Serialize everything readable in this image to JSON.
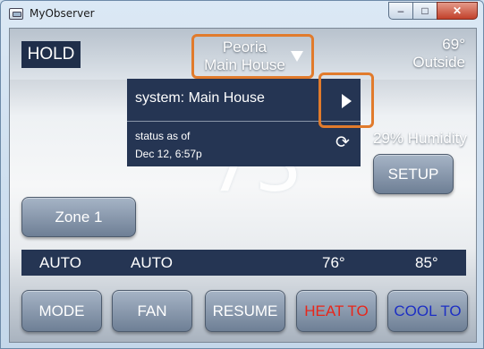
{
  "window": {
    "title": "MyObserver",
    "controls": {
      "minimize": "–",
      "maximize": "□",
      "close": "✕"
    },
    "icon": "app-window-icon"
  },
  "header": {
    "hold_label": "HOLD",
    "location": {
      "city": "Peoria",
      "name": "Main House",
      "icon": "caret-down-icon"
    },
    "outside": {
      "temp": "69°",
      "label": "Outside"
    }
  },
  "current_temp": "73°",
  "system_popup": {
    "system_label": "system: Main House",
    "status_line1": "status as of",
    "status_line2": "Dec 12, 6:57p",
    "icons": {
      "next": "play-arrow-icon",
      "refresh": "refresh-icon"
    },
    "refresh_glyph": "⟳"
  },
  "humidity": "29% Humidity",
  "setup_label": "SETUP",
  "zone_label": "Zone 1",
  "settings": {
    "mode": "AUTO",
    "fan": "AUTO",
    "heat_to": "76°",
    "cool_to": "85°"
  },
  "buttons": {
    "mode": "MODE",
    "fan": "FAN",
    "resume": "RESUME",
    "heat_to": "HEAT TO",
    "cool_to": "COOL TO"
  },
  "colors": {
    "accent_highlight": "#e17b2c",
    "panel": "#253553",
    "heat": "#e8261a",
    "cool": "#1d2fc4"
  }
}
